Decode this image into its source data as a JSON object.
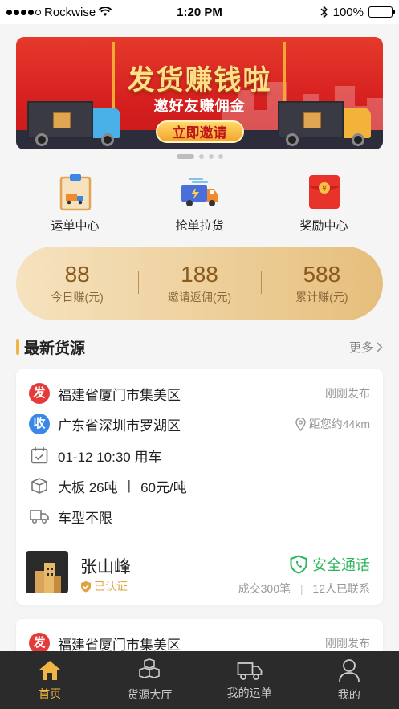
{
  "status_bar": {
    "carrier": "Rockwise",
    "time": "1:20 PM",
    "battery": "100%"
  },
  "banner": {
    "title": "发货赚钱啦",
    "subtitle": "邀好友赚佣金",
    "button_label": "立即邀请",
    "page_count": 4,
    "active_page": 1
  },
  "quick_menu": [
    {
      "label": "运单中心",
      "icon": "clipboard-truck-icon"
    },
    {
      "label": "抢单拉货",
      "icon": "fast-truck-icon"
    },
    {
      "label": "奖励中心",
      "icon": "red-envelope-icon"
    }
  ],
  "stats": [
    {
      "value": "88",
      "label": "今日赚(元)"
    },
    {
      "value": "188",
      "label": "邀请返佣(元)"
    },
    {
      "value": "588",
      "label": "累计赚(元)"
    }
  ],
  "section": {
    "title": "最新货源",
    "more_label": "更多"
  },
  "cargo_cards": [
    {
      "from_tag": "发",
      "from": "福建省厦门市集美区",
      "posted": "刚刚发布",
      "to_tag": "收",
      "to": "广东省深圳市罗湖区",
      "distance": "距您约44km",
      "time": "01-12 10:30 用车",
      "cargo": "大板 26吨",
      "price": "60元/吨",
      "truck_type": "车型不限",
      "owner_name": "张山峰",
      "verified_label": "已认证",
      "call_label": "安全通话",
      "deals": "成交300笔",
      "contacted": "12人已联系"
    },
    {
      "from_tag": "发",
      "from": "福建省厦门市集美区",
      "posted": "刚刚发布"
    }
  ],
  "tabbar": [
    {
      "label": "首页",
      "icon": "home-icon",
      "active": true
    },
    {
      "label": "货源大厅",
      "icon": "boxes-icon",
      "active": false
    },
    {
      "label": "我的运单",
      "icon": "truck-icon",
      "active": false
    },
    {
      "label": "我的",
      "icon": "user-icon",
      "active": false
    }
  ],
  "colors": {
    "accent": "#f0b543",
    "red_tag": "#e53a3a",
    "blue_tag": "#3a87e6",
    "green_call": "#2db55d",
    "tabbar_bg": "#2b2b2b"
  }
}
